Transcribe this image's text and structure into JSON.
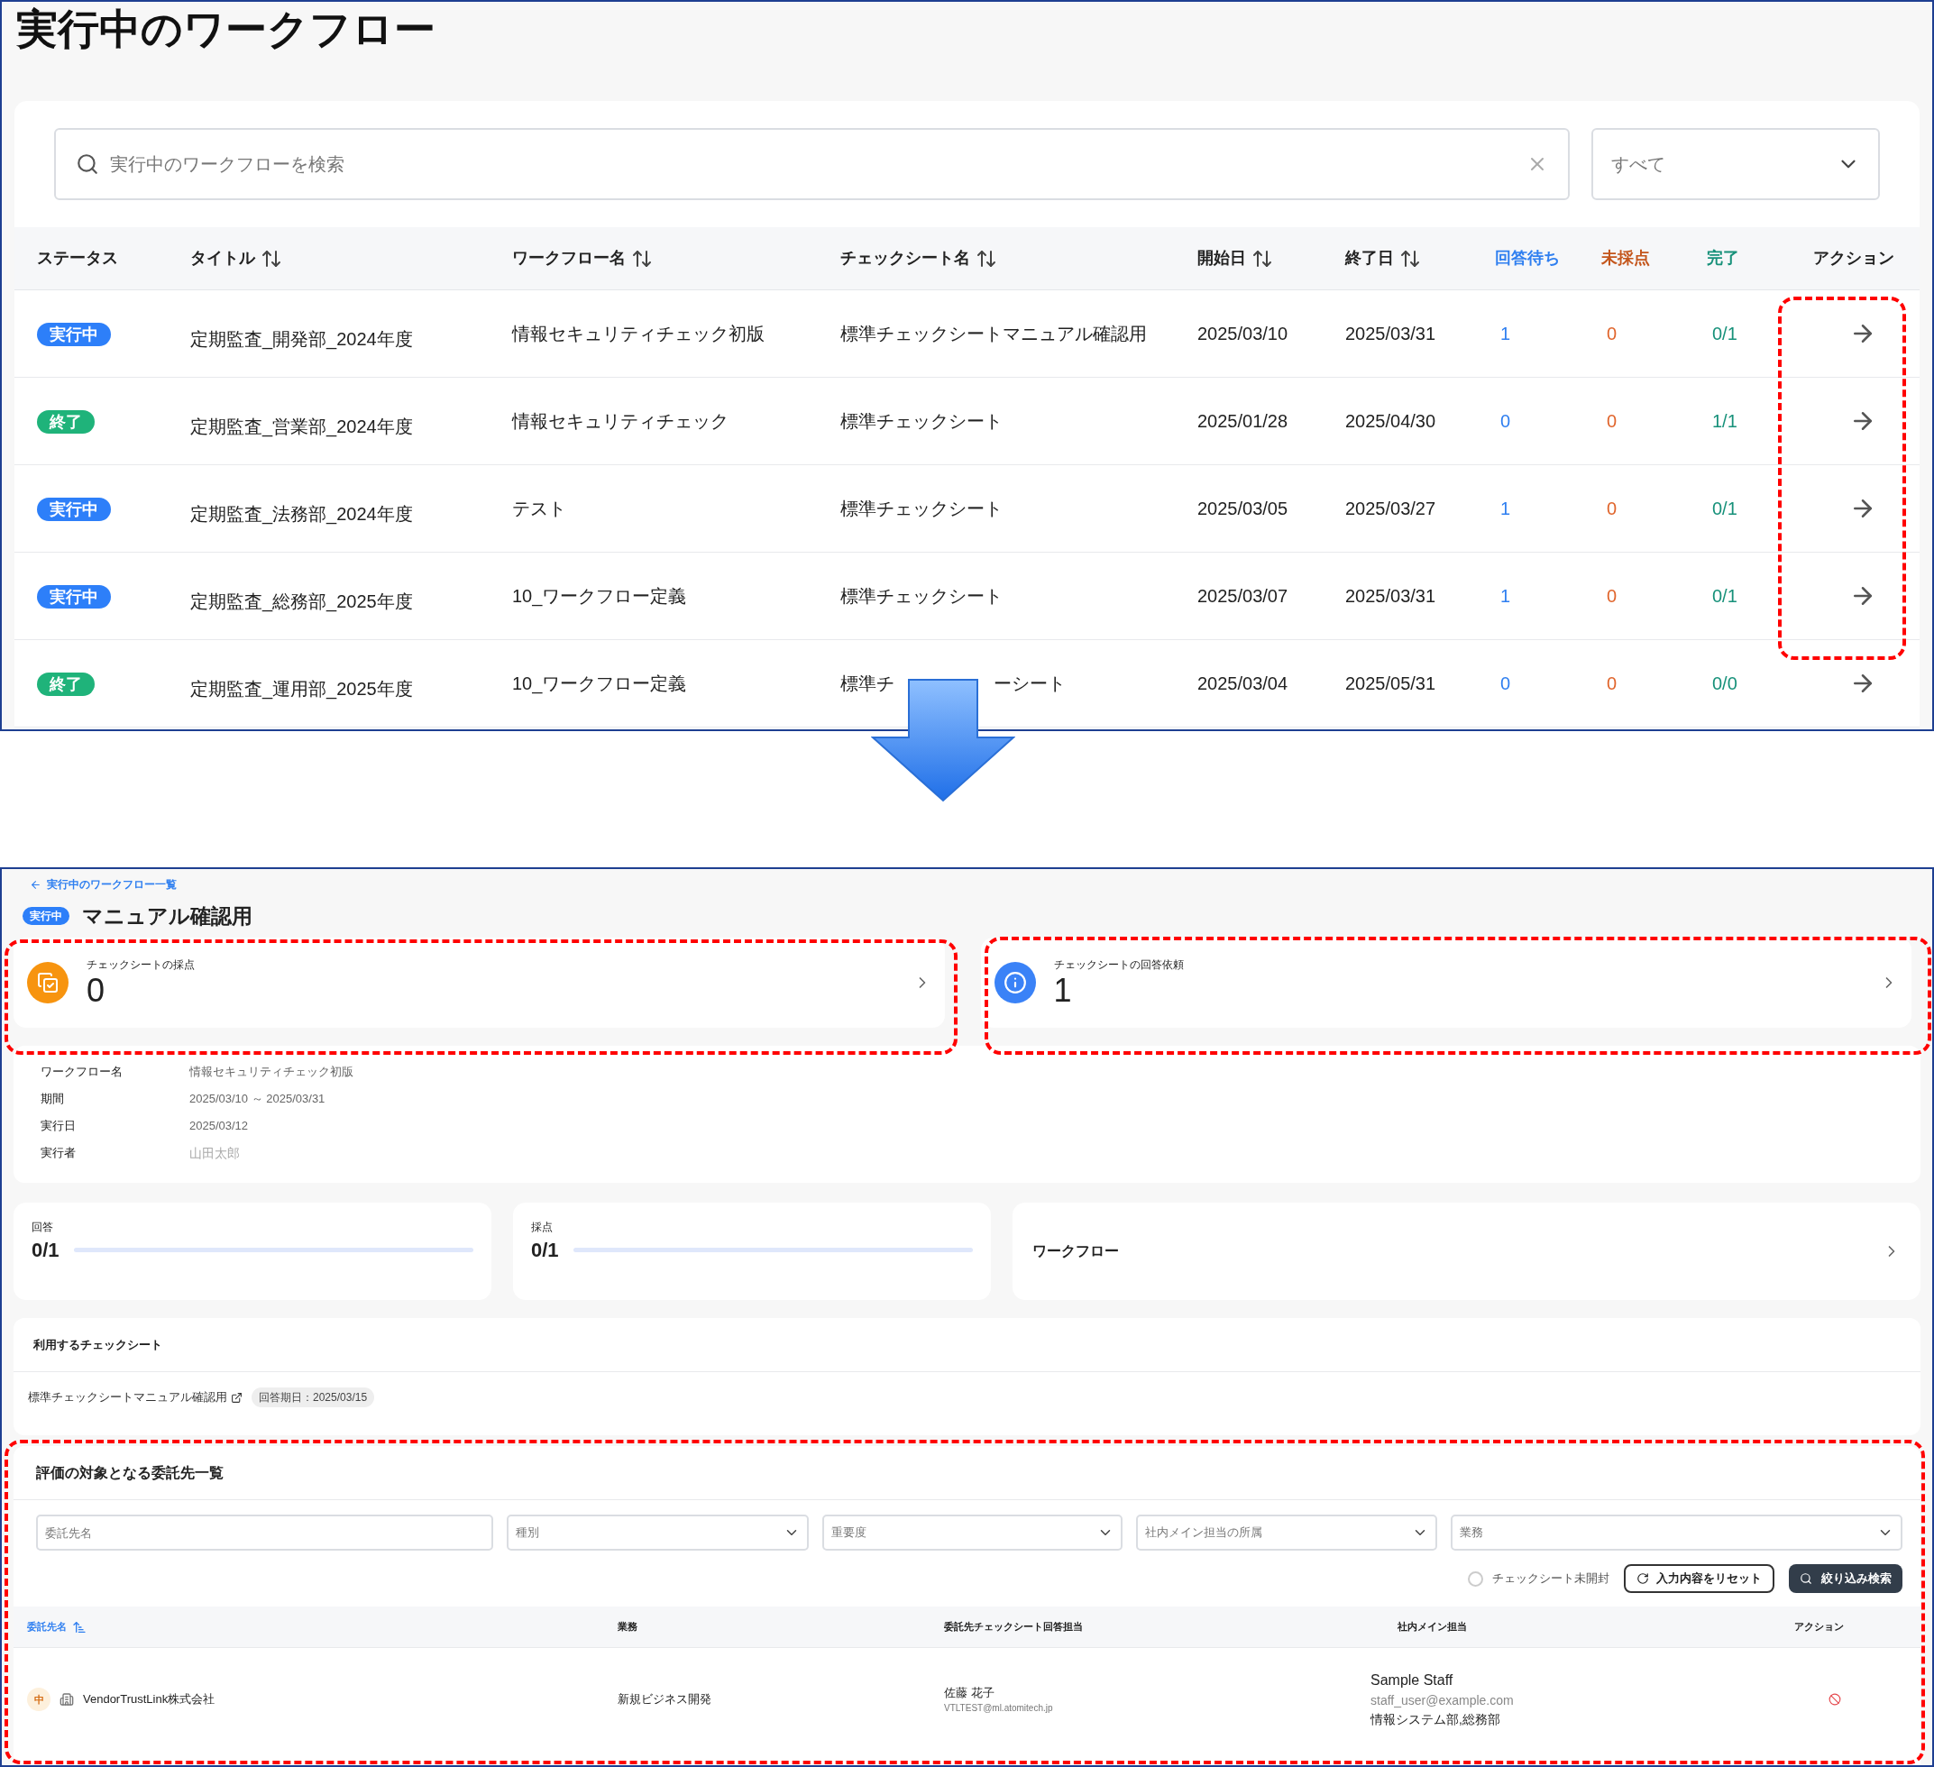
{
  "list_screen": {
    "title": "実行中のワークフロー",
    "search": {
      "placeholder": "実行中のワークフローを検索"
    },
    "filter": {
      "value": "すべて"
    },
    "columns": [
      {
        "label": "ステータス",
        "sortable": false
      },
      {
        "label": "タイトル",
        "sortable": true
      },
      {
        "label": "ワークフロー名",
        "sortable": true
      },
      {
        "label": "チェックシート名",
        "sortable": true
      },
      {
        "label": "開始日",
        "sortable": true
      },
      {
        "label": "終了日",
        "sortable": true
      },
      {
        "label": "回答待ち",
        "sortable": false,
        "color": "#2f7ff0"
      },
      {
        "label": "未採点",
        "sortable": false,
        "color": "#c4561c"
      },
      {
        "label": "完了",
        "sortable": false,
        "color": "#17917a"
      },
      {
        "label": "アクション",
        "sortable": false
      }
    ],
    "rows": [
      {
        "status": {
          "label": "実行中",
          "kind": "running"
        },
        "title": "定期監査_開発部_2024年度",
        "workflow": "情報セキュリティチェック初版",
        "checksheet": [
          "標準チェックシートマニュアル確認用"
        ],
        "start": "2025/03/10",
        "end": "2025/03/31",
        "waiting": "1",
        "unscored": "0",
        "complete": "0/1"
      },
      {
        "status": {
          "label": "終了",
          "kind": "done"
        },
        "title": "定期監査_営業部_2024年度",
        "workflow": "情報セキュリティチェック",
        "checksheet": [
          "標準チェックシート"
        ],
        "start": "2025/01/28",
        "end": "2025/04/30",
        "waiting": "0",
        "unscored": "0",
        "complete": "1/1"
      },
      {
        "status": {
          "label": "実行中",
          "kind": "running"
        },
        "title": "定期監査_法務部_2024年度",
        "workflow": "テスト",
        "checksheet": [
          "標準チェックシート"
        ],
        "start": "2025/03/05",
        "end": "2025/03/27",
        "waiting": "1",
        "unscored": "0",
        "complete": "0/1"
      },
      {
        "status": {
          "label": "実行中",
          "kind": "running"
        },
        "title": "定期監査_総務部_2025年度",
        "workflow": "10_ワークフロー定義",
        "checksheet": [
          "標準チェックシート"
        ],
        "start": "2025/03/07",
        "end": "2025/03/31",
        "waiting": "1",
        "unscored": "0",
        "complete": "0/1"
      },
      {
        "status": {
          "label": "終了",
          "kind": "done"
        },
        "title": "定期監査_運用部_2025年度",
        "workflow": "10_ワークフロー定義",
        "checksheet": [
          "標準チ",
          "ーシート"
        ],
        "start": "2025/03/04",
        "end": "2025/05/31",
        "waiting": "0",
        "unscored": "0",
        "complete": "0/0"
      }
    ]
  },
  "detail_screen": {
    "back_link": "実行中のワークフロー一覧",
    "status": {
      "label": "実行中",
      "kind": "running"
    },
    "title": "マニュアル確認用",
    "summary_cards": [
      {
        "kind": "scoring",
        "label": "チェックシートの採点",
        "value": "0"
      },
      {
        "kind": "request",
        "label": "チェックシートの回答依頼",
        "value": "1"
      }
    ],
    "info": [
      {
        "label": "ワークフロー名",
        "value": "情報セキュリティチェック初版",
        "dimmed": false
      },
      {
        "label": "期間",
        "value": "2025/03/10 ～ 2025/03/31",
        "dimmed": false
      },
      {
        "label": "実行日",
        "value": "2025/03/12",
        "dimmed": false
      },
      {
        "label": "実行者",
        "value": "山田太郎",
        "dimmed": true
      }
    ],
    "progress": [
      {
        "label": "回答",
        "value": "0/1",
        "level": 0
      },
      {
        "label": "採点",
        "value": "0/1",
        "level": 0
      }
    ],
    "workflow_link": "ワークフロー",
    "checksheets": {
      "title": "利用するチェックシート",
      "items": [
        {
          "name": "標準チェックシートマニュアル確認用",
          "due": "回答期日：2025/03/15"
        }
      ]
    },
    "outsourcees": {
      "title": "評価の対象となる委託先一覧",
      "filters": [
        {
          "kind": "text",
          "placeholder": "委託先名"
        },
        {
          "kind": "select",
          "placeholder": "種別"
        },
        {
          "kind": "select",
          "placeholder": "重要度"
        },
        {
          "kind": "select",
          "placeholder": "社内メイン担当の所属"
        },
        {
          "kind": "select",
          "placeholder": "業務"
        }
      ],
      "unopened": {
        "label": "チェックシート未開封",
        "checked": false
      },
      "buttons": [
        {
          "kind": "reset",
          "label": "入力内容をリセット"
        },
        {
          "kind": "search",
          "label": "絞り込み検索"
        }
      ],
      "columns": [
        {
          "label": "委託先名",
          "sorted": true
        },
        {
          "label": "業務",
          "sorted": false
        },
        {
          "label": "委託先チェックシート回答担当",
          "sorted": false
        },
        {
          "label": "社内メイン担当",
          "sorted": false
        },
        {
          "label": "アクション",
          "sorted": false
        }
      ],
      "rows": [
        {
          "importance": "中",
          "name": "VendorTrustLink株式会社",
          "business": "新規ビジネス開発",
          "respondent": {
            "name": "佐藤 花子",
            "email": "VTLTEST@ml.atomitech.jp"
          },
          "staff": {
            "name": "Sample Staff",
            "email": "staff_user@example.com",
            "department": "情報システム部,総務部"
          }
        }
      ]
    }
  }
}
